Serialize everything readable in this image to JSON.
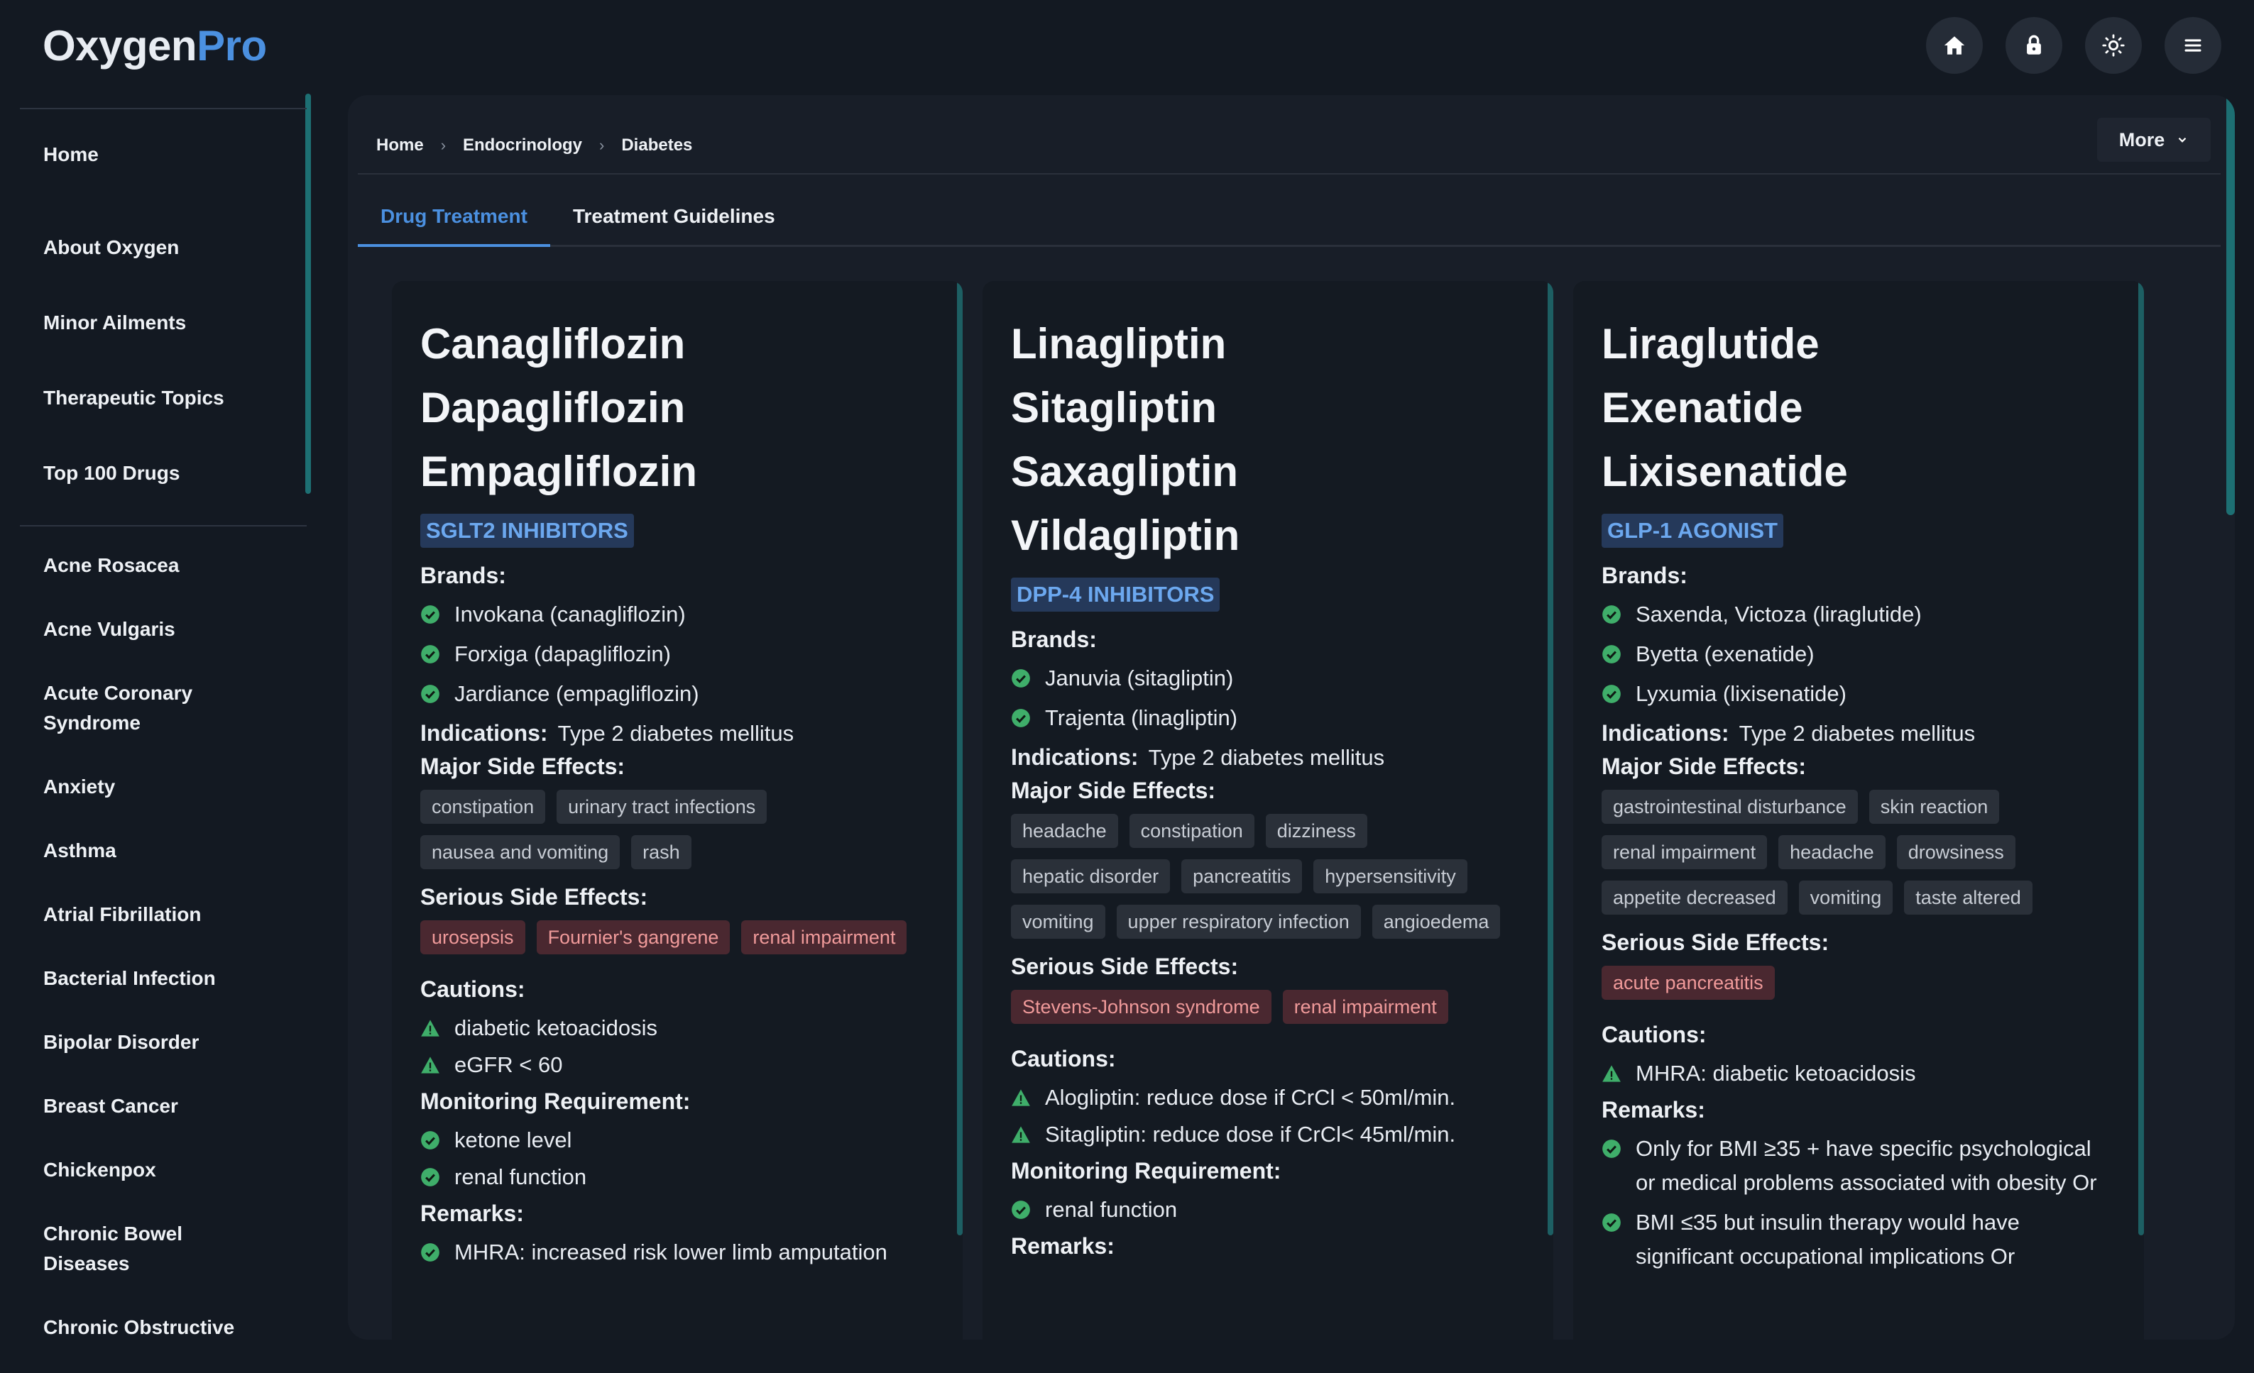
{
  "logo": {
    "part1": "Oxygen",
    "part2": "Pro"
  },
  "top_actions": [
    "home-icon",
    "lock-icon",
    "sun-icon",
    "menu-icon"
  ],
  "sidebar": {
    "primary": [
      "Home",
      "About Oxygen",
      "Minor Ailments",
      "Therapeutic Topics",
      "Top 100 Drugs"
    ],
    "topics": [
      "Acne Rosacea",
      "Acne Vulgaris",
      "Acute Coronary Syndrome",
      "Anxiety",
      "Asthma",
      "Atrial Fibrillation",
      "Bacterial Infection",
      "Bipolar Disorder",
      "Breast Cancer",
      "Chickenpox",
      "Chronic Bowel Diseases",
      "Chronic Obstructive"
    ]
  },
  "breadcrumb": [
    "Home",
    "Endocrinology",
    "Diabetes"
  ],
  "more_label": "More",
  "tabs": [
    "Drug Treatment",
    "Treatment Guidelines"
  ],
  "labels": {
    "brands": "Brands:",
    "indications": "Indications:",
    "major": "Major Side Effects:",
    "serious": "Serious Side Effects:",
    "cautions": "Cautions:",
    "monitoring": "Monitoring Requirement:",
    "remarks": "Remarks:"
  },
  "cards": [
    {
      "drugs": [
        "Canagliflozin",
        "Dapagliflozin",
        "Empagliflozin"
      ],
      "class": "SGLT2 INHIBITORS",
      "brands": [
        "Invokana (canagliflozin)",
        "Forxiga (dapagliflozin)",
        "Jardiance (empagliflozin)"
      ],
      "indications": "Type 2 diabetes mellitus",
      "major": [
        "constipation",
        "urinary tract infections",
        "nausea and vomiting",
        "rash"
      ],
      "serious": [
        "urosepsis",
        "Fournier's gangrene",
        "renal impairment"
      ],
      "cautions": [
        "diabetic ketoacidosis",
        "eGFR < 60"
      ],
      "monitoring": [
        "ketone level",
        "renal function"
      ],
      "remarks": [
        "MHRA: increased risk lower limb amputation"
      ]
    },
    {
      "drugs": [
        "Linagliptin",
        "Sitagliptin",
        "Saxagliptin",
        "Vildagliptin"
      ],
      "class": "DPP-4 INHIBITORS",
      "brands": [
        "Januvia (sitagliptin)",
        "Trajenta (linagliptin)"
      ],
      "indications": "Type 2 diabetes mellitus",
      "major": [
        "headache",
        "constipation",
        "dizziness",
        "hepatic disorder",
        "pancreatitis",
        "hypersensitivity",
        "vomiting",
        "upper respiratory infection",
        "angioedema"
      ],
      "serious": [
        "Stevens-Johnson syndrome",
        "renal impairment"
      ],
      "cautions": [
        "Alogliptin: reduce dose if CrCl < 50ml/min.",
        "Sitagliptin: reduce dose if CrCl< 45ml/min."
      ],
      "monitoring": [
        "renal function"
      ],
      "remarks": []
    },
    {
      "drugs": [
        "Liraglutide",
        "Exenatide",
        "Lixisenatide"
      ],
      "class": "GLP-1 AGONIST",
      "brands": [
        "Saxenda, Victoza (liraglutide)",
        "Byetta (exenatide)",
        "Lyxumia (lixisenatide)"
      ],
      "indications": "Type 2 diabetes mellitus",
      "major": [
        "gastrointestinal disturbance",
        "skin reaction",
        "renal impairment",
        "headache",
        "drowsiness",
        "appetite decreased",
        "vomiting",
        "taste altered"
      ],
      "serious": [
        "acute pancreatitis"
      ],
      "cautions": [
        "MHRA: diabetic ketoacidosis"
      ],
      "monitoring": [],
      "remarks": [
        "Only for BMI ≥35 + have specific psychological or medical problems associated with obesity Or",
        "BMI ≤35 but insulin therapy would have significant occupational implications Or"
      ]
    }
  ],
  "colors": {
    "accent": "#4b90e0",
    "check": "#3fae6a",
    "warn": "#3fae6a",
    "serious_chip": "#4a2830"
  }
}
